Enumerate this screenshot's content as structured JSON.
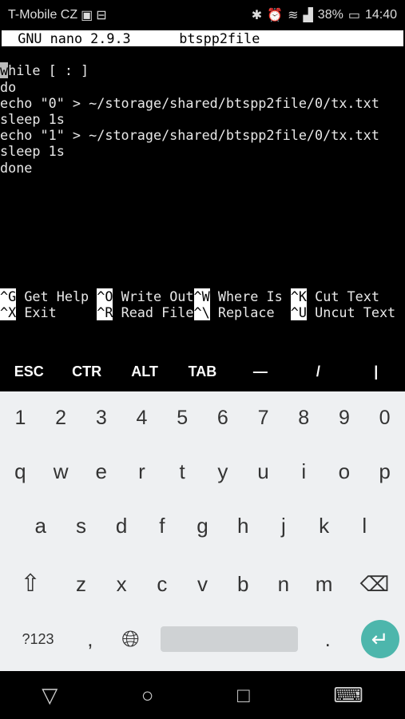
{
  "status_bar": {
    "carrier": "T-Mobile CZ",
    "battery": "38%",
    "time": "14:40",
    "icons": [
      "sim-icon",
      "briefcase-icon",
      "bluetooth-icon",
      "alarm-icon",
      "wifi-icon",
      "signal-icon",
      "battery-charging-icon"
    ]
  },
  "nano": {
    "version": "GNU nano 2.9.3",
    "filename": "btspp2file",
    "cursor_char": "w",
    "lines": [
      "hile [ : ]",
      "do",
      "echo \"0\" > ~/storage/shared/btspp2file/0/tx.txt",
      "sleep 1s",
      "echo \"1\" > ~/storage/shared/btspp2file/0/tx.txt",
      "sleep 1s",
      "done"
    ],
    "shortcuts": [
      [
        {
          "key": "^G",
          "label": " Get Help "
        },
        {
          "key": "^O",
          "label": " Write Out"
        },
        {
          "key": "^W",
          "label": " Where Is "
        },
        {
          "key": "^K",
          "label": " Cut Text"
        }
      ],
      [
        {
          "key": "^X",
          "label": " Exit     "
        },
        {
          "key": "^R",
          "label": " Read File"
        },
        {
          "key": "^\\",
          "label": " Replace  "
        },
        {
          "key": "^U",
          "label": " Uncut Text"
        }
      ]
    ]
  },
  "extra_keys": [
    "ESC",
    "CTR",
    "ALT",
    "TAB",
    "—",
    "/",
    "|"
  ],
  "keyboard": {
    "numbers": [
      "1",
      "2",
      "3",
      "4",
      "5",
      "6",
      "7",
      "8",
      "9",
      "0"
    ],
    "row1": [
      "q",
      "w",
      "e",
      "r",
      "t",
      "y",
      "u",
      "i",
      "o",
      "p"
    ],
    "row2": [
      "a",
      "s",
      "d",
      "f",
      "g",
      "h",
      "j",
      "k",
      "l"
    ],
    "row3": [
      "z",
      "x",
      "c",
      "v",
      "b",
      "n",
      "m"
    ],
    "symbols": "?123",
    "comma": ",",
    "period": ".",
    "accent": "#4db6ac"
  },
  "nav": {
    "back": "▽",
    "home": "○",
    "recents": "□",
    "keyboard": "⌨"
  }
}
